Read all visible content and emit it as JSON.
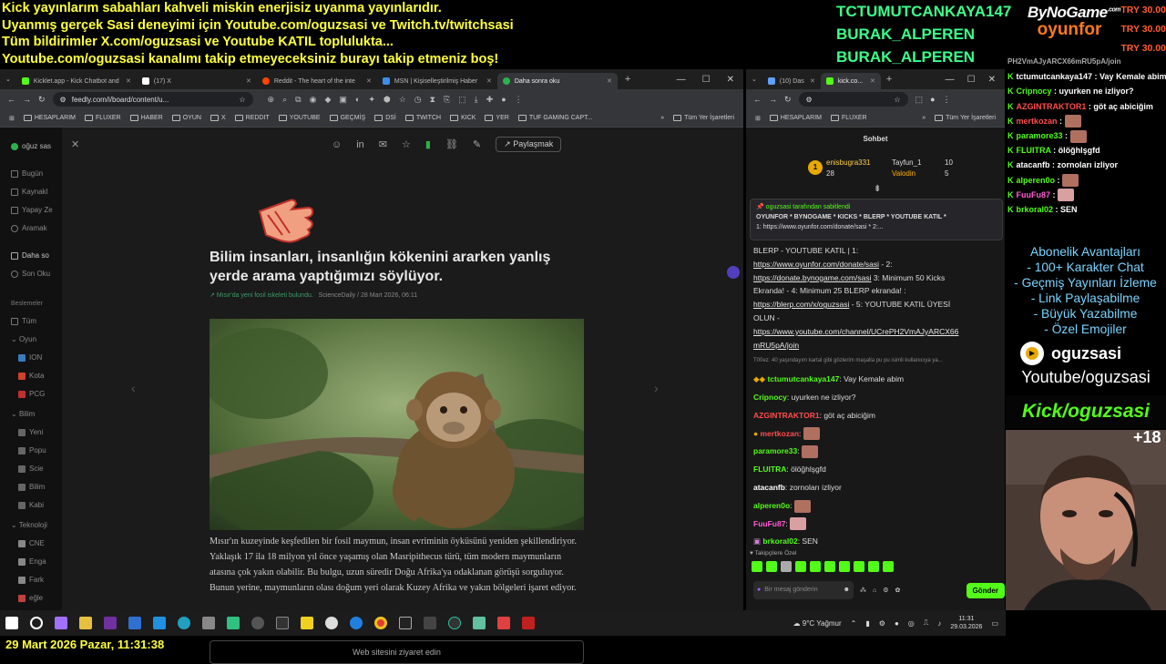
{
  "overlay": {
    "lines": [
      "Kick yayınlarım sabahları kahveli miskin enerjisiz uyanma yayınlarıdır.",
      "Uyanmış gerçek Sasi deneyimi için Youtube.com/oguzsasi ve Twitch.tv/twitchsasi",
      "Tüm bildirimler X.com/oguzsasi ve Youtube KATIL toplulukta...",
      "Youtube.com/oguzsasi kanalımı takip etmeyeceksiniz burayı takip etmeniz boş!"
    ],
    "donors": [
      "TCTUMUTCANKAYA147",
      "BURAK_ALPEREN",
      "BURAK_ALPEREN"
    ],
    "brand_top": "ByNoGame",
    "brand_com": ".com",
    "brand_bottom": "oyunfor",
    "try": [
      "TRY 30.00",
      "TRY 30.00",
      "TRY 30.00"
    ],
    "datetime": "29 Mart 2026 Pazar, 11:31:38"
  },
  "left_browser": {
    "tabs": [
      {
        "label": "Kicklet.app - Kick Chatbot and",
        "color": "#53fc18"
      },
      {
        "label": "(17) X",
        "color": "#ffffff"
      },
      {
        "label": "Reddit - The heart of the inte",
        "color": "#ff4500"
      },
      {
        "label": "MSN | Kişiselleştirilmiş Haber",
        "color": "#3b8eea"
      },
      {
        "label": "Daha sonra oku",
        "color": "#2bb24c"
      }
    ],
    "url": "feedly.com/i/board/content/u...",
    "bookmarks": [
      "HESAPLARIM",
      "FLUXER",
      "HABER",
      "OYUN",
      "X",
      "REDDIT",
      "YOUTUBE",
      "GEÇMİŞ",
      "DSİ",
      "TWITCH",
      "KICK",
      "YER",
      "TUF GAMING CAPT..."
    ],
    "all_bookmarks": "Tüm Yer İşaretleri"
  },
  "feedly": {
    "user": "oğuz sas",
    "nav": [
      "Bugün",
      "Kaynakl",
      "Yapay Ze",
      "Aramak",
      "Daha so",
      "Son Oku"
    ],
    "section_label": "Beslemeler",
    "all": "Tüm",
    "groups": [
      {
        "name": "Oyun",
        "items": [
          "ION",
          "Kota",
          "PCG"
        ]
      },
      {
        "name": "Bilim",
        "items": [
          "Yeni",
          "Popu",
          "Scie",
          "Bilim",
          "Kabi"
        ]
      },
      {
        "name": "Teknoloji",
        "items": [
          "CNE",
          "Enga",
          "Fark",
          "eğle"
        ]
      }
    ],
    "share_label": "Paylaşmak",
    "article": {
      "title": "Bilim insanları, insanlığın kökenini ararken yanlış yerde arama yaptığımızı söylüyor.",
      "topic": "Mısır'da yeni fosil iskeleti bulundu.",
      "source": "ScienceDaily",
      "date": "28 Mart 2026, 06:11",
      "body": "Mısır'ın kuzeyinde keşfedilen bir fosil maymun, insan evriminin öyküsünü yeniden şekillendiriyor. Yaklaşık 17 ila 18 milyon yıl önce yaşamış olan Masripithecus türü, tüm modern maymunların atasına çok yakın olabilir. Bu bulgu, uzun süredir Doğu Afrika'ya odaklanan görüşü sorguluyor. Bunun yerine, maymunların olası doğum yeri olarak Kuzey Afrika ve yakın bölgeleri işaret ediyor.",
      "visit_label": "Web sitesini ziyaret edin"
    }
  },
  "right_browser": {
    "tabs": [
      "(10) Das",
      "kick.co..."
    ],
    "bookmarks": [
      "HESAPLARIM",
      "FLUXER"
    ],
    "all_bookmarks": "Tüm Yer İşaretleri",
    "chat_title": "Sohbet",
    "top_gifters": [
      {
        "rank": "1",
        "name": "enisbugra331",
        "count": "28"
      },
      {
        "name": "Tayfun_1",
        "count": "10"
      },
      {
        "name": "Valodin",
        "count": "5"
      }
    ],
    "pinned_by": "oguzsasi tarafından sabitlendi",
    "pinned_text": "OYUNFOR * BYNOGAME * KICKS * BLERP * YOUTUBE KATIL *",
    "pinned_text2": "1: https://www.oyunfor.com/donate/sasi * 2:...",
    "body_lines": [
      {
        "text": "BLERP - YOUTUBE KATIL | 1:",
        "link": false
      },
      {
        "text": "https://www.oyunfor.com/donate/sasi",
        "link": true,
        "suffix": " - 2:"
      },
      {
        "text": "https://donate.bynogame.com/sasi",
        "link": true,
        "suffix": " 3: Minimum 50 Kicks"
      },
      {
        "text": "Ekranda! - 4: Minimum 25 BLERP ekranda! :",
        "link": false
      },
      {
        "text": "https://blerp.com/x/oguzsasi",
        "link": true,
        "suffix": " - 5: YOUTUBE KATIL ÜYESİ"
      },
      {
        "text": "OLUN -",
        "link": false
      },
      {
        "text": "https://www.youtube.com/channel/UCrePH2VmAJyARCX66",
        "link": true
      },
      {
        "text": "mRU5pA/join",
        "link": true
      }
    ],
    "reply_ref": "T00ez: 40 yaşındayım kartal gibi gözlerim maşalla pu pu isimli kullanıcıya ya...",
    "messages": [
      {
        "user": "tctumutcankaya147",
        "color": "#53fc18",
        "text": "Vay Kemale abim"
      },
      {
        "user": "Cripnocy",
        "color": "#53fc18",
        "text": "uyurken ne izliyor?"
      },
      {
        "user": "AZGINTRAKTOR1",
        "color": "#ff4d4d",
        "text": "göt aç abiciğim"
      },
      {
        "user": "mertkozan",
        "color": "#ff4d4d",
        "text": ""
      },
      {
        "user": "paramore33",
        "color": "#53fc18",
        "text": ""
      },
      {
        "user": "FLUITRA",
        "color": "#53fc18",
        "text": "ölöğhlşgfd"
      },
      {
        "user": "atacanfb",
        "color": "#ffffff",
        "text": "zornoları izliyor"
      },
      {
        "user": "alperen0o",
        "color": "#53fc18",
        "text": ""
      },
      {
        "user": "FuuFu87",
        "color": "#ff5ad4",
        "text": ""
      },
      {
        "user": "brkoral02",
        "color": "#53fc18",
        "text": "SEN"
      }
    ],
    "followers_label": "Takipçilere Özel",
    "input_placeholder": "Bir mesaj gönderin",
    "send_label": "Gönder"
  },
  "chat_overlay": {
    "header": "PH2VmAJyARCX66mRU5pA/join",
    "messages": [
      {
        "user": "tctumutcankaya147",
        "color": "#ffffff",
        "text": "Vay Kemale abim"
      },
      {
        "user": "Cripnocy",
        "color": "#53fc18",
        "text": "uyurken ne izliyor?"
      },
      {
        "user": "AZGINTRAKTOR1",
        "color": "#ff4d4d",
        "text": "göt aç abiciğim"
      },
      {
        "user": "mertkozan",
        "color": "#ff4d4d",
        "text": ""
      },
      {
        "user": "paramore33",
        "color": "#53fc18",
        "text": ""
      },
      {
        "user": "FLUITRA",
        "color": "#53fc18",
        "text": "ölöğhlşgfd"
      },
      {
        "user": "atacanfb",
        "color": "#ffffff",
        "text": "zornoları izliyor"
      },
      {
        "user": "alperen0o",
        "color": "#53fc18",
        "text": ""
      },
      {
        "user": "FuuFu87",
        "color": "#ff5ad4",
        "text": ""
      },
      {
        "user": "brkoral02",
        "color": "#53fc18",
        "text": "SEN"
      }
    ],
    "perks": [
      "Abonelik Avantajları",
      "- 100+ Karakter Chat",
      "- Geçmiş Yayınları İzleme",
      "- Link Paylaşabilme",
      "- Büyük Yazabilme",
      "- Özel Emojiler"
    ],
    "yt_handle": "oguzsasi",
    "yt_line": "Youtube/oguzsasi",
    "kick_line": "Kick/oguzsasi",
    "age": "+18"
  },
  "taskbar": {
    "weather": "9°C  Yağmur",
    "time": "11:31",
    "date": "29.03.2026"
  }
}
